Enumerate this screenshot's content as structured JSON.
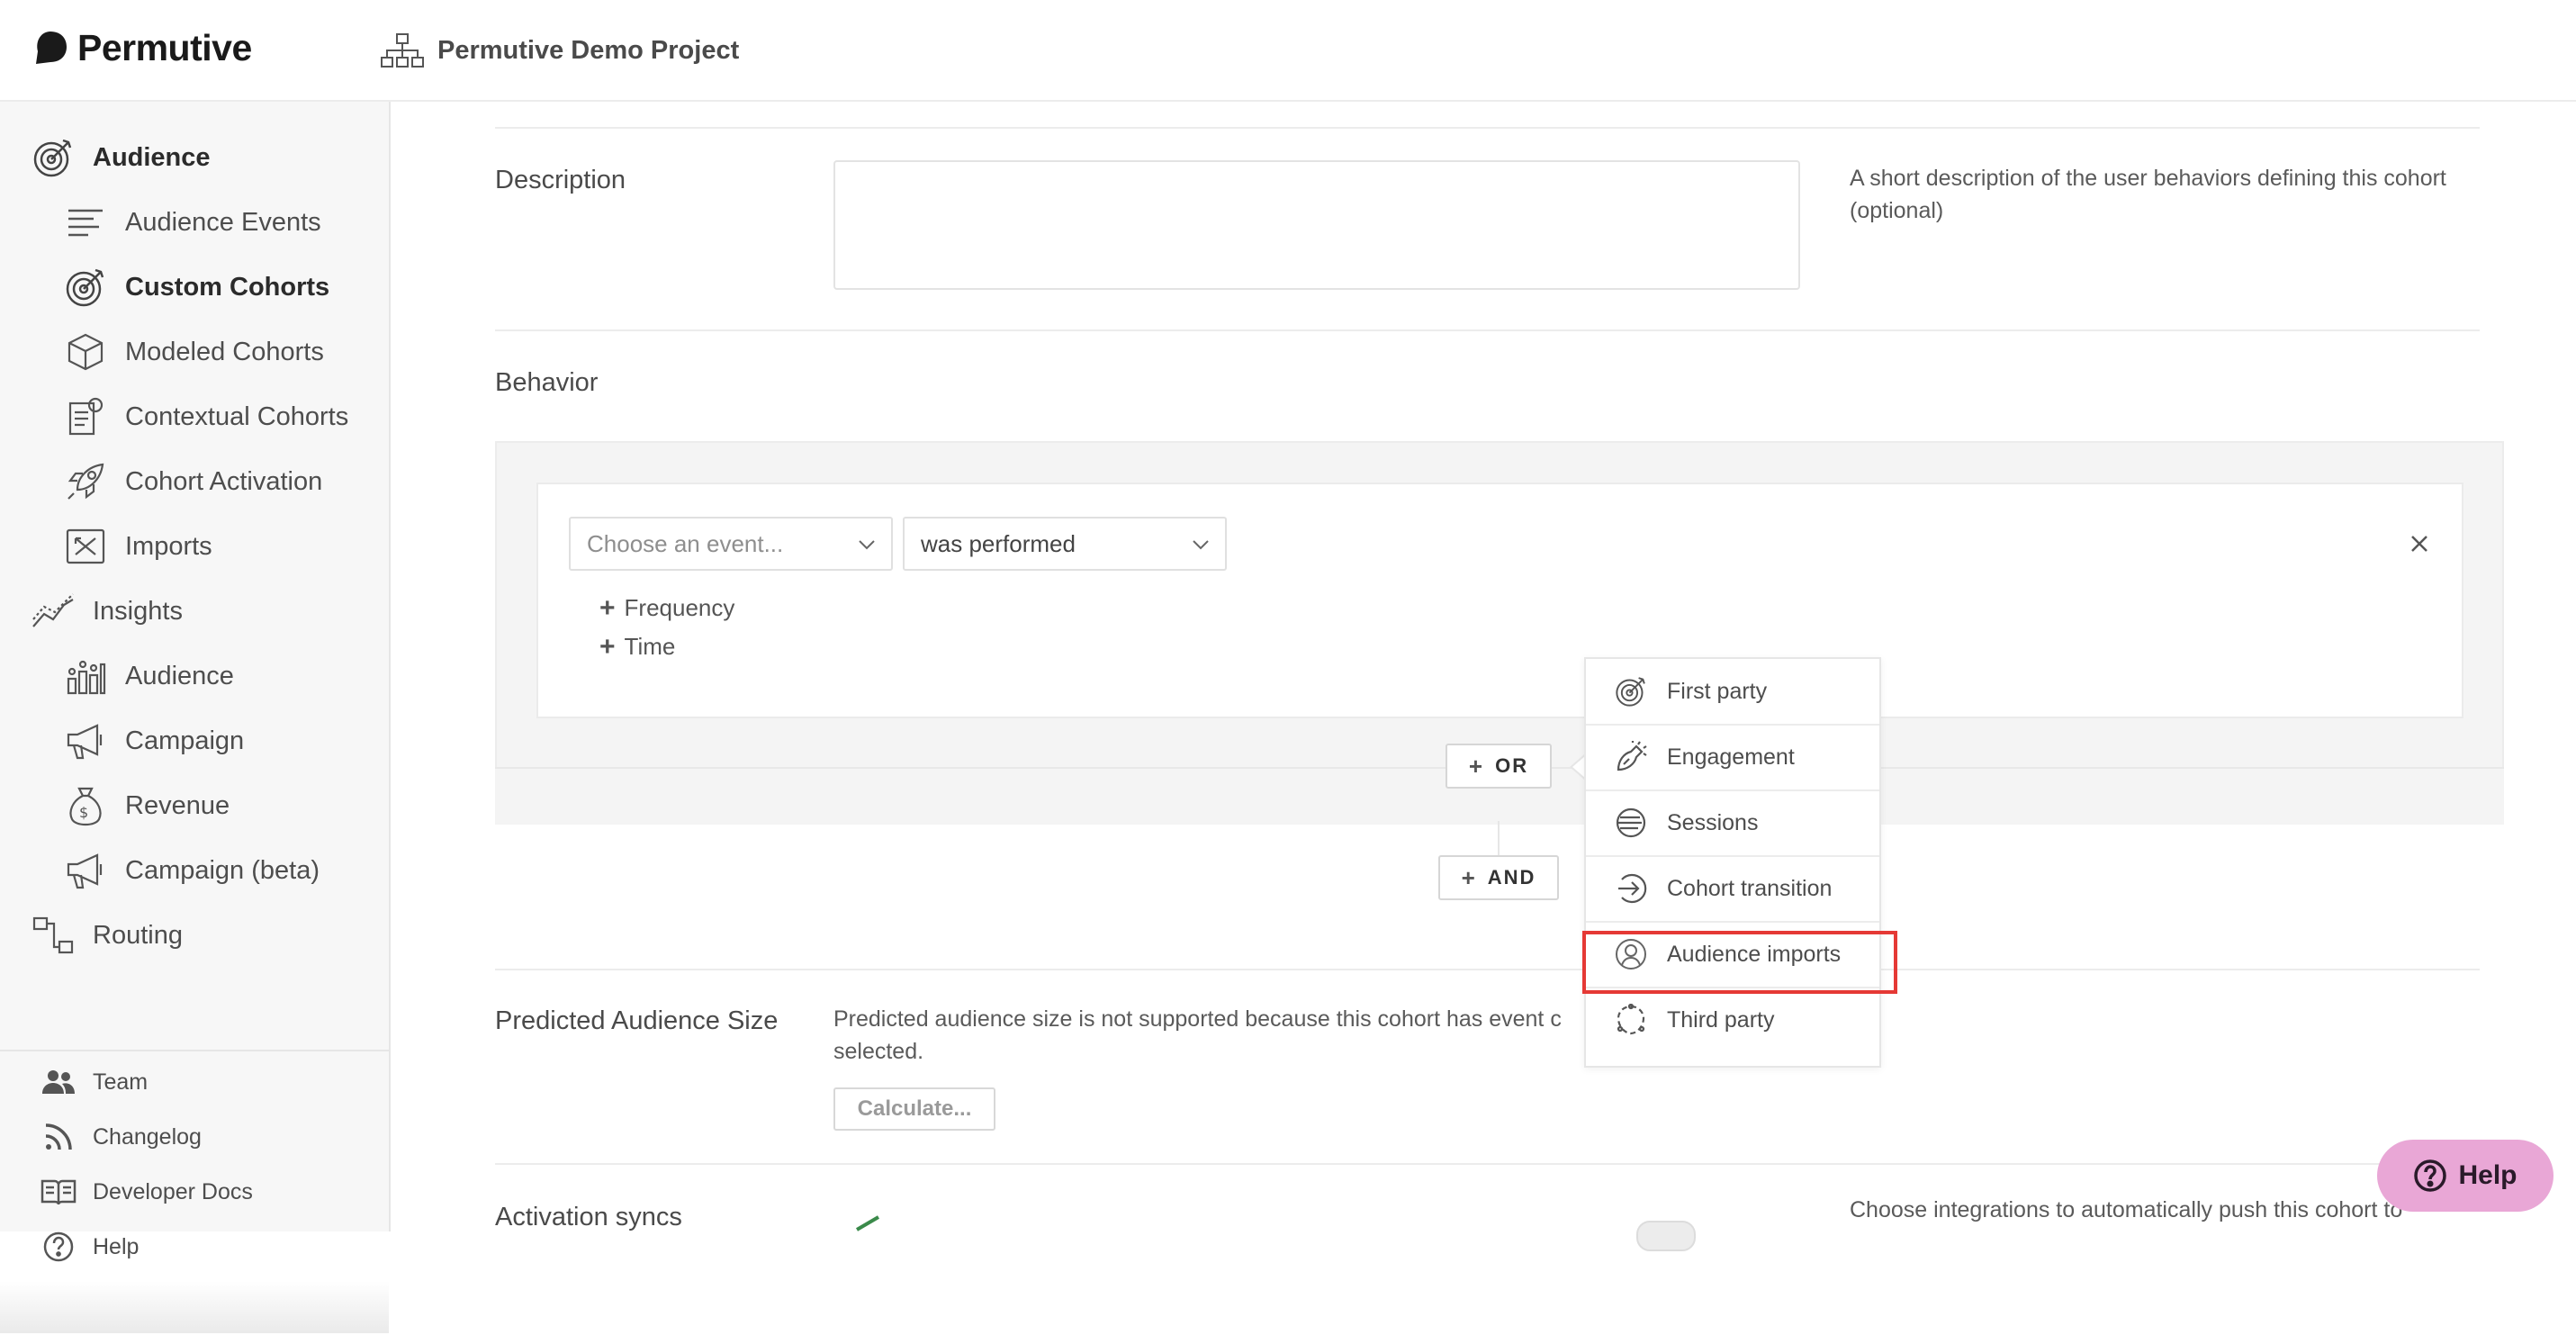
{
  "app": {
    "brand": "Permutive",
    "project": "Permutive Demo Project"
  },
  "sidebar": {
    "sections": [
      {
        "label": "Audience",
        "icon": "target-icon"
      },
      {
        "label": "Audience Events",
        "icon": "lines-icon"
      },
      {
        "label": "Custom Cohorts",
        "icon": "target-icon"
      },
      {
        "label": "Modeled Cohorts",
        "icon": "cube-icon"
      },
      {
        "label": "Contextual Cohorts",
        "icon": "document-icon"
      },
      {
        "label": "Cohort Activation",
        "icon": "rocket-icon"
      },
      {
        "label": "Imports",
        "icon": "import-icon"
      },
      {
        "label": "Insights",
        "icon": "trend-icon"
      },
      {
        "label": "Audience",
        "icon": "bar-chart-icon"
      },
      {
        "label": "Campaign",
        "icon": "megaphone-icon"
      },
      {
        "label": "Revenue",
        "icon": "money-bag-icon"
      },
      {
        "label": "Campaign (beta)",
        "icon": "megaphone-icon"
      },
      {
        "label": "Routing",
        "icon": "routing-icon"
      }
    ],
    "bottom": [
      {
        "label": "Team",
        "icon": "team-icon"
      },
      {
        "label": "Changelog",
        "icon": "rss-icon"
      },
      {
        "label": "Developer Docs",
        "icon": "book-icon"
      },
      {
        "label": "Help",
        "icon": "help-circle-icon"
      }
    ]
  },
  "form": {
    "description": {
      "label": "Description",
      "value": "",
      "help": "A short description of the user behaviors defining this cohort (optional)"
    },
    "behavior": {
      "label": "Behavior",
      "event_placeholder": "Choose an event...",
      "condition_value": "was performed",
      "frequency_label": "Frequency",
      "time_label": "Time",
      "or_label": "OR",
      "and_label": "AND"
    },
    "predicted": {
      "label": "Predicted Audience Size",
      "text": "Predicted audience size is not supported because this cohort has event c",
      "text2": "selected.",
      "button": "Calculate..."
    },
    "activation": {
      "label": "Activation syncs",
      "help": "Choose integrations to automatically push this cohort to"
    }
  },
  "menu": {
    "items": [
      {
        "label": "First party",
        "icon": "target-icon"
      },
      {
        "label": "Engagement",
        "icon": "engagement-icon"
      },
      {
        "label": "Sessions",
        "icon": "sessions-icon"
      },
      {
        "label": "Cohort transition",
        "icon": "transition-arrow-icon"
      },
      {
        "label": "Audience imports",
        "icon": "person-circle-icon"
      },
      {
        "label": "Third party",
        "icon": "third-party-icon"
      }
    ],
    "highlighted": "Audience imports"
  },
  "help_button": {
    "label": "Help"
  }
}
